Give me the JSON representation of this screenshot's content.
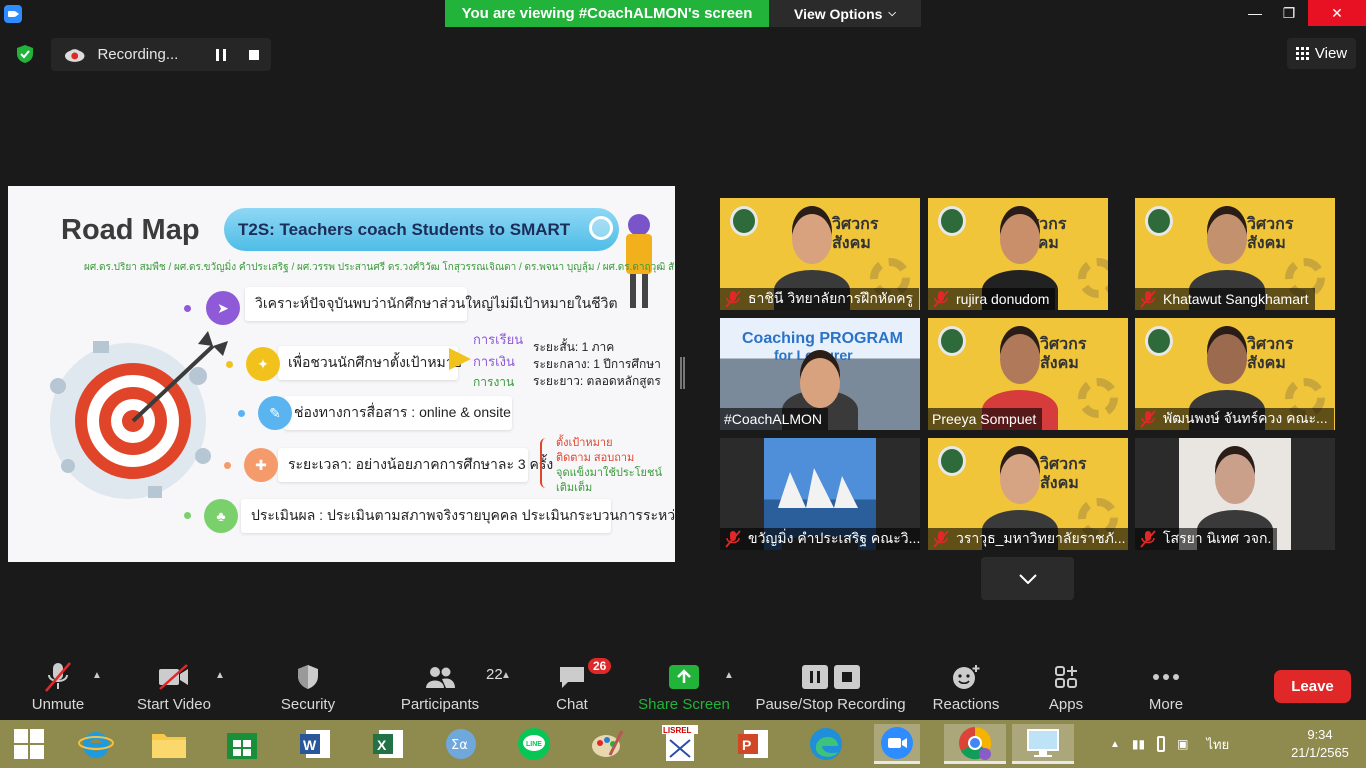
{
  "window": {
    "viewing_banner": "You are viewing #CoachALMON's screen",
    "view_options_label": "View Options",
    "minimize": "—",
    "maximize": "❐",
    "close": "✕"
  },
  "recording": {
    "label": "Recording..."
  },
  "view_button": {
    "label": "View"
  },
  "slide": {
    "title": "Road Map",
    "pill_text": "T2S: Teachers coach Students to SMART",
    "authors": "ผศ.ดร.ปริยา สมพืช / ผศ.ดร.ขวัญมิ่ง คำประเสริฐ / ผศ.วรรพ ประสานศรี ดร.วงศ์วิวัฒ โกสุวรรณเจิณดา / ดร.พจนา บุญลุ้ม / ผศ.ดร.ดาฤวุฒิ สังขมาศ",
    "rows": [
      {
        "text": "วิเคราะห์ปัจจุบันพบว่านักศึกษาส่วนใหญ่ไม่มีเป้าหมายในชีวิต",
        "icon": "paper-plane-icon",
        "color": "#8e5ad8"
      },
      {
        "text": "เพื่อชวนนักศึกษาตั้งเป้าหมาย",
        "icon": "puzzle-icon",
        "color": "#f2c21c"
      },
      {
        "text": "ช่องทางการสื่อสาร : online & onsite",
        "icon": "pencil-icon",
        "color": "#5ab4ef"
      },
      {
        "text": "ระยะเวลา: อย่างน้อยภาคการศึกษาละ 3 ครั้ง",
        "icon": "target-icon",
        "color": "#f59a6b"
      },
      {
        "text": "ประเมินผล : ประเมินตามสภาพจริงรายบุคคล ประเมินกระบวนการระหว่างทาง",
        "icon": "people-icon",
        "color": "#7ad06b"
      }
    ],
    "goals": [
      "การเรียน",
      "การเงิน",
      "การงาน"
    ],
    "terms": [
      "ระยะสั้น:   1 ภาค",
      "ระยะกลาง:   1 ปีการศึกษา",
      "ระยะยาว:  ตลอดหลักสูตร"
    ],
    "followups": [
      "ตั้งเป้าหมาย",
      "ติดตาม สอบถาม",
      "จุดแข็งมาใช้ประโยชน์",
      "เติมเต็ม"
    ]
  },
  "participants_grid": [
    {
      "name": "ธาชินี  วิทยาลัยการฝึกหัดครู",
      "muted": true,
      "bg": "branded"
    },
    {
      "name": "rujira donudom",
      "muted": true,
      "bg": "branded"
    },
    {
      "name": "Khatawut Sangkhamart",
      "muted": true,
      "bg": "branded"
    },
    {
      "name": "#CoachALMON",
      "muted": false,
      "bg": "coaching",
      "overlay_line1": "Coaching PROGRAM",
      "overlay_line2": "for Lecturer"
    },
    {
      "name": "Preeya Sompuet",
      "muted": false,
      "bg": "branded",
      "speaking": true
    },
    {
      "name": "พัฒนพงษ์ จันทร์ควง คณะ...",
      "muted": true,
      "bg": "branded"
    },
    {
      "name": "ขวัญมิ่ง คำประเสริฐ คณะวิ...",
      "muted": true,
      "bg": "opera"
    },
    {
      "name": "วราวุธ_มหาวิทยาลัยราชภั...",
      "muted": true,
      "bg": "branded"
    },
    {
      "name": "โสรยา นิเทศ วจก.",
      "muted": true,
      "bg": "plain"
    }
  ],
  "brand_text": "วิศวกรสังคม",
  "toolbar": {
    "unmute": "Unmute",
    "start_video": "Start Video",
    "security": "Security",
    "participants": "Participants",
    "participants_count": "22",
    "chat": "Chat",
    "chat_badge": "26",
    "share_screen": "Share Screen",
    "pause_stop_recording": "Pause/Stop Recording",
    "reactions": "Reactions",
    "apps": "Apps",
    "more": "More",
    "leave": "Leave"
  },
  "taskbar": {
    "apps": [
      "windows-start",
      "internet-explorer",
      "file-explorer",
      "microsoft-store",
      "word",
      "excel",
      "calculator",
      "line",
      "paint",
      "lisrel",
      "powerpoint",
      "edge",
      "zoom",
      "chrome",
      "remote-desktop"
    ],
    "language": "ไทย",
    "time": "9:34",
    "date": "21/1/2565"
  },
  "colors": {
    "accent_green": "#22b33a",
    "leave_red": "#e02828",
    "speaker_outline": "#d6ff4a",
    "taskbar": "#8f8a4e"
  }
}
